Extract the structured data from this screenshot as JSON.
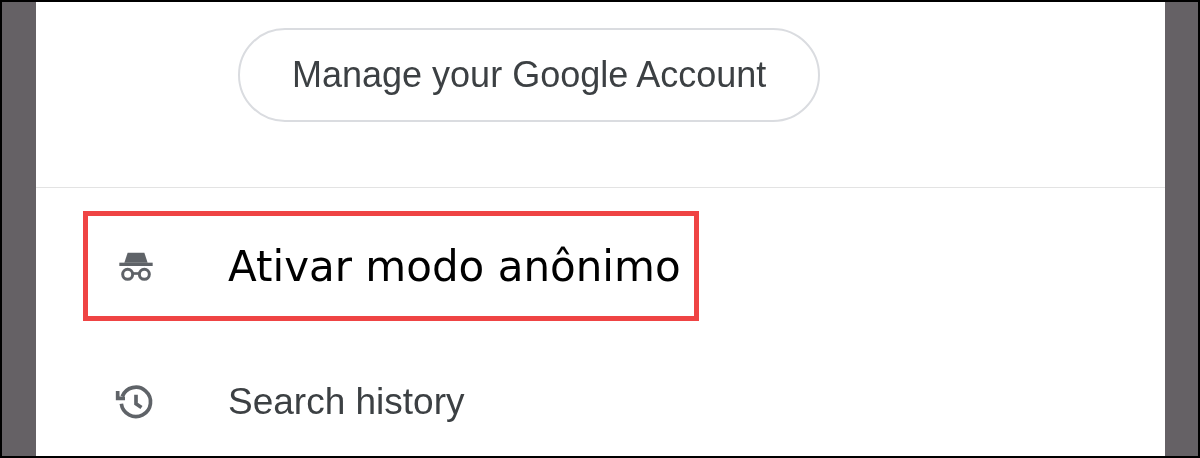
{
  "account_button": {
    "label": "Manage your Google Account"
  },
  "menu_items": [
    {
      "label": "Ativar modo anônimo",
      "kind": "incognito",
      "highlighted": true
    },
    {
      "label": "Search history",
      "kind": "history",
      "highlighted": false
    }
  ]
}
